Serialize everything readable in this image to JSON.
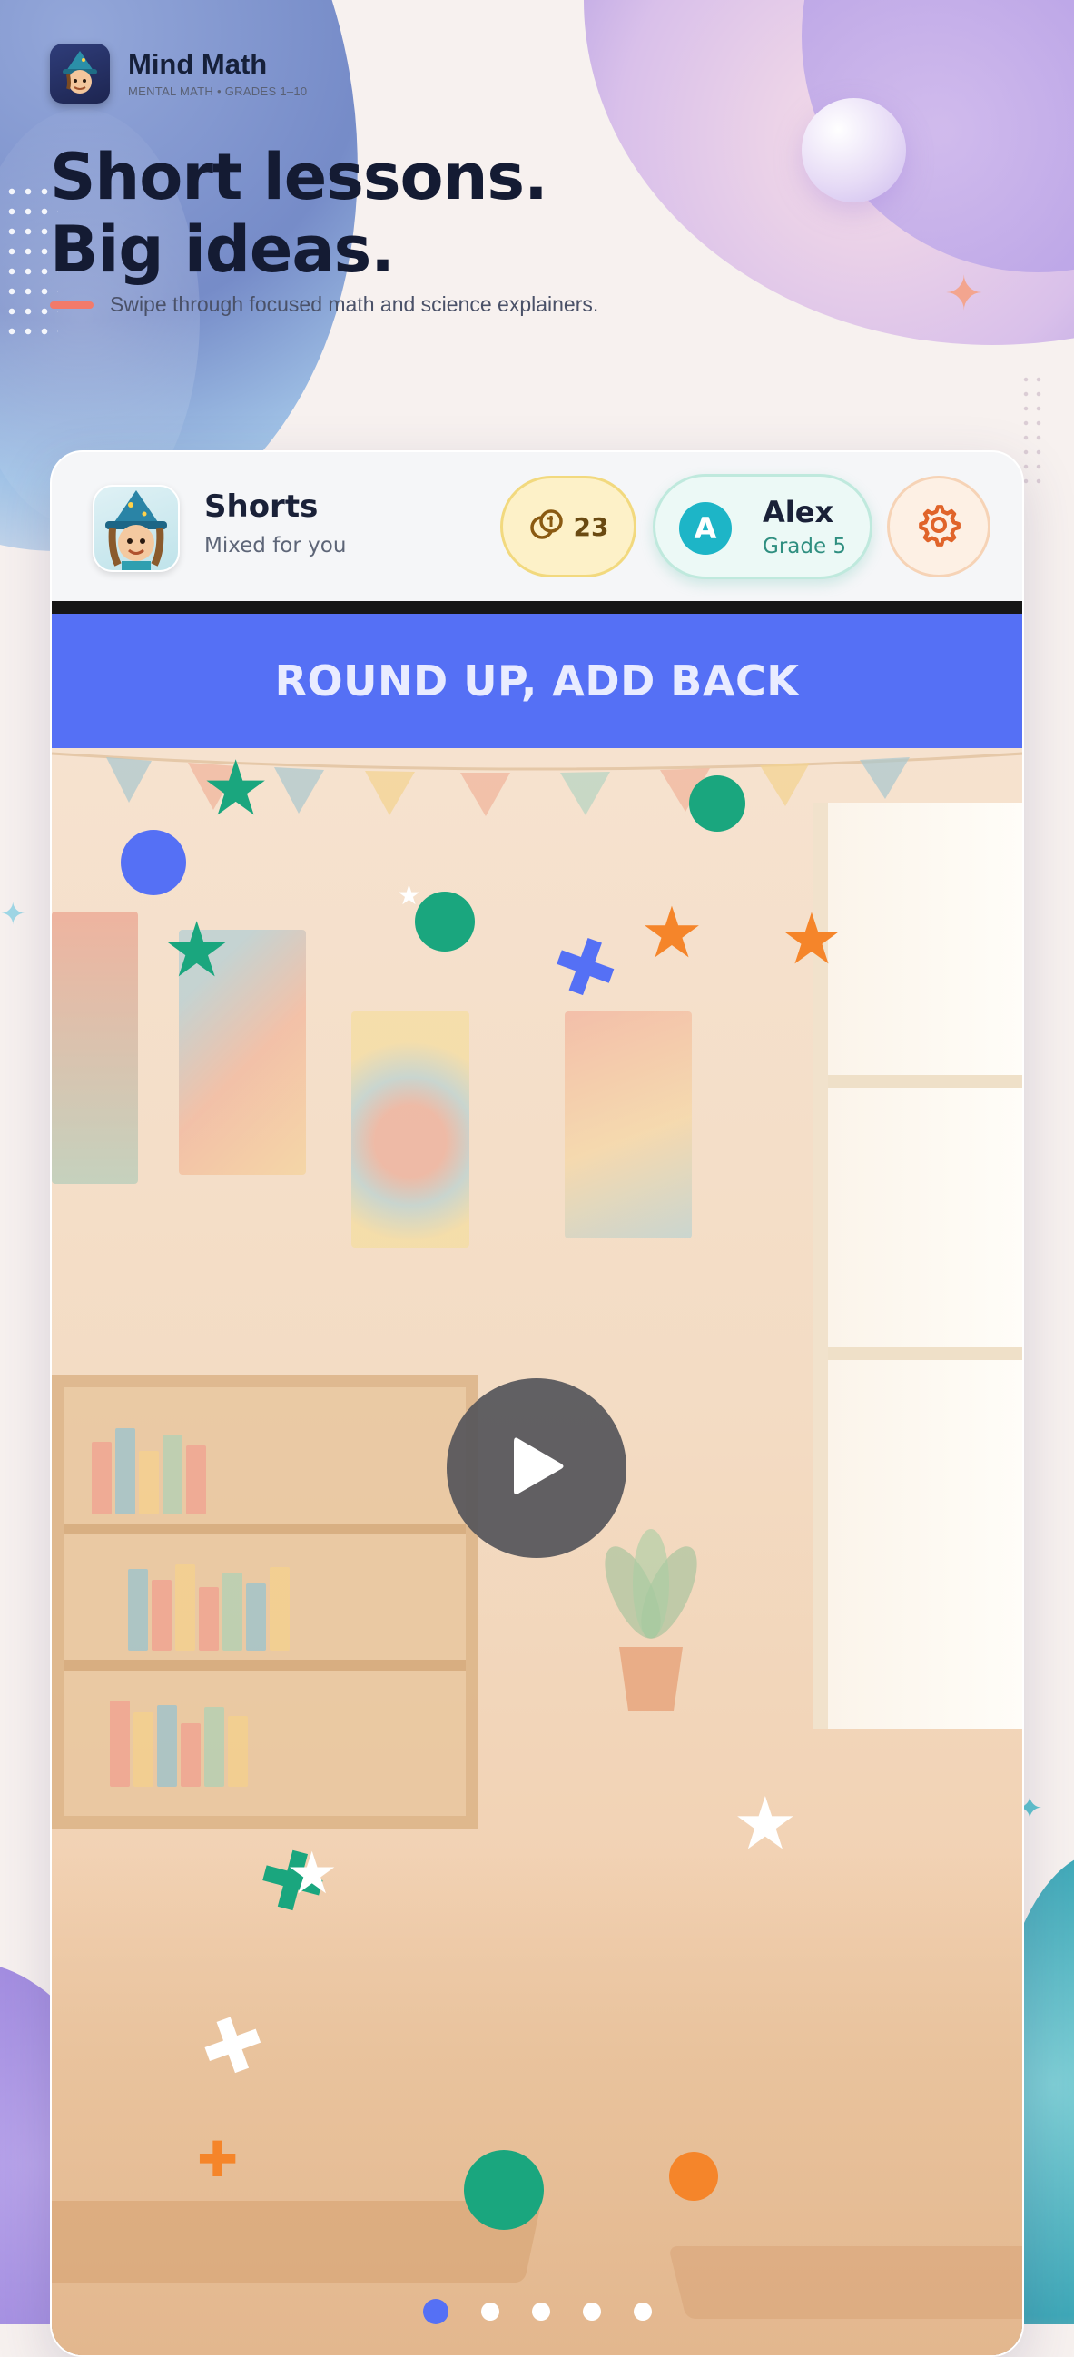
{
  "brand": {
    "name": "Mind Math",
    "subtitle": "MENTAL MATH • GRADES 1–10"
  },
  "hero": {
    "title_line1": "Short lessons.",
    "title_line2": "Big ideas.",
    "subtitle": "Swipe through focused math and science explainers."
  },
  "topbar": {
    "title": "Shorts",
    "subtitle": "Mixed for you",
    "coins": "23",
    "user_initial": "A",
    "user_name": "Alex",
    "user_grade": "Grade 5",
    "icons": {
      "avatar": "wizard-avatar-icon",
      "coins": "coin-icon",
      "settings": "gear-icon"
    }
  },
  "video": {
    "banner_title": "ROUND UP, ADD BACK",
    "play_icon": "play-icon",
    "pager": {
      "total": 5,
      "active_index": 1
    }
  },
  "colors": {
    "accent_blue": "#5570f5",
    "teal": "#1db5c7",
    "coral": "#f27a6a",
    "confetti_green": "#1aa67e",
    "confetti_orange": "#f5852a"
  }
}
